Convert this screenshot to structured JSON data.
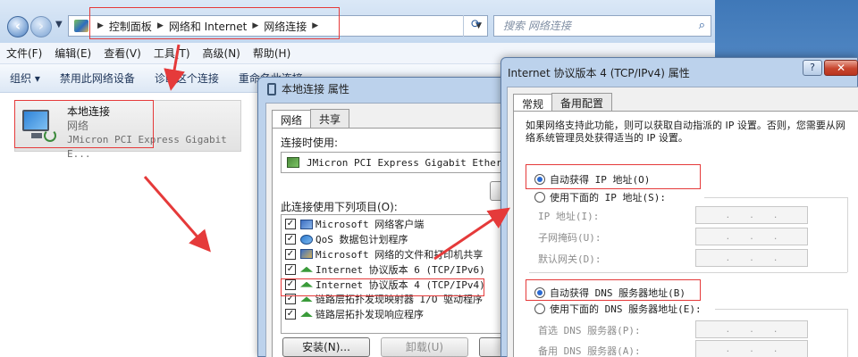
{
  "explorer": {
    "address": {
      "crumbs": [
        "控制面板",
        "网络和 Internet",
        "网络连接"
      ],
      "search_placeholder": "搜索 网络连接"
    },
    "menu": [
      "文件(F)",
      "编辑(E)",
      "查看(V)",
      "工具(T)",
      "高级(N)",
      "帮助(H)"
    ],
    "commands": [
      "组织 ▾",
      "禁用此网络设备",
      "诊断这个连接",
      "重命名此连接"
    ],
    "connection": {
      "name": "本地连接",
      "network": "网络",
      "device": "JMicron PCI Express Gigabit E..."
    }
  },
  "lan_dialog": {
    "title": "本地连接 属性",
    "tabs": [
      "网络",
      "共享"
    ],
    "connect_using_label": "连接时使用:",
    "device": "JMicron PCI Express Gigabit Etherne",
    "items_label": "此连接使用下列项目(O):",
    "items": [
      {
        "label": "Microsoft 网络客户端",
        "checked": true,
        "icon": "client-icon"
      },
      {
        "label": "QoS 数据包计划程序",
        "checked": true,
        "icon": "qos-icon"
      },
      {
        "label": "Microsoft 网络的文件和打印机共享",
        "checked": true,
        "icon": "share-icon"
      },
      {
        "label": "Internet 协议版本 6 (TCP/IPv6)",
        "checked": true,
        "icon": "protocol-icon"
      },
      {
        "label": "Internet 协议版本 4 (TCP/IPv4)",
        "checked": true,
        "icon": "protocol-icon"
      },
      {
        "label": "链路层拓扑发现映射器 I/O 驱动程序",
        "checked": true,
        "icon": "protocol-icon"
      },
      {
        "label": "链路层拓扑发现响应程序",
        "checked": true,
        "icon": "protocol-icon"
      }
    ],
    "buttons": {
      "install": "安装(N)...",
      "uninstall": "卸载(U)"
    }
  },
  "ipv4_dialog": {
    "title": "Internet 协议版本 4 (TCP/IPv4) 属性",
    "help_label": "?",
    "close_label": "✕",
    "tabs": [
      "常规",
      "备用配置"
    ],
    "description": "如果网络支持此功能，则可以获取自动指派的 IP 设置。否则，您需要从网络系统管理员处获得适当的 IP 设置。",
    "ip": {
      "auto_label": "自动获得 IP 地址(O)",
      "manual_label": "使用下面的 IP 地址(S):",
      "selected": "auto",
      "fields": [
        "IP 地址(I):",
        "子网掩码(U):",
        "默认网关(D):"
      ]
    },
    "dns": {
      "auto_label": "自动获得 DNS 服务器地址(B)",
      "manual_label": "使用下面的 DNS 服务器地址(E):",
      "selected": "auto",
      "fields": [
        "首选 DNS 服务器(P):",
        "备用 DNS 服务器(A):"
      ]
    },
    "ip_dot": "."
  },
  "colors": {
    "annotation": "#e53a3a",
    "title_bar": "#bcd2ec",
    "radio_selected": "#2a6ad2"
  }
}
